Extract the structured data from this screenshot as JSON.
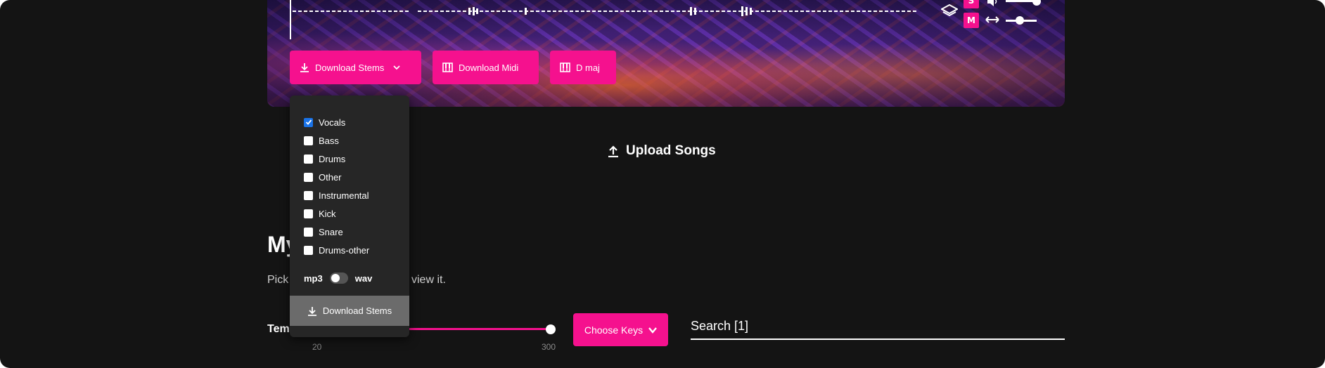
{
  "player": {
    "solo_label": "S",
    "mute_label": "M",
    "volume_level": 0.75,
    "pan_level": 0.5
  },
  "actions": {
    "download_stems_label": "Download Stems",
    "download_midi_label": "Download Midi",
    "key_label": "D maj"
  },
  "stem_menu": {
    "stems": [
      {
        "label": "Vocals",
        "checked": true
      },
      {
        "label": "Bass",
        "checked": false
      },
      {
        "label": "Drums",
        "checked": false
      },
      {
        "label": "Other",
        "checked": false
      },
      {
        "label": "Instrumental",
        "checked": false
      },
      {
        "label": "Kick",
        "checked": false
      },
      {
        "label": "Snare",
        "checked": false
      },
      {
        "label": "Drums-other",
        "checked": false
      }
    ],
    "format_left": "mp3",
    "format_right": "wav",
    "format_selected": "mp3",
    "download_button_label": "Download Stems"
  },
  "upload": {
    "label": "Upload Songs"
  },
  "library": {
    "heading_partial": "My",
    "subtext_visible_start": "Pick",
    "subtext_visible_end": "view it."
  },
  "filters": {
    "tempo_label": "Tem",
    "tempo_min_tick": "20",
    "tempo_max_tick": "300",
    "tempo_max_value": 300,
    "choose_keys_label": "Choose Keys",
    "search_label": "Search [1]"
  },
  "colors": {
    "accent": "#f5118e",
    "background": "#141414",
    "menu_bg": "#262626",
    "checkbox_checked": "#1a73e8"
  },
  "icons": {
    "download": "download-icon",
    "chevron": "chevron-down-icon",
    "piano": "piano-icon",
    "upload": "upload-icon",
    "logo": "logo-icon",
    "speaker": "speaker-icon",
    "pan": "pan-arrows-icon"
  }
}
